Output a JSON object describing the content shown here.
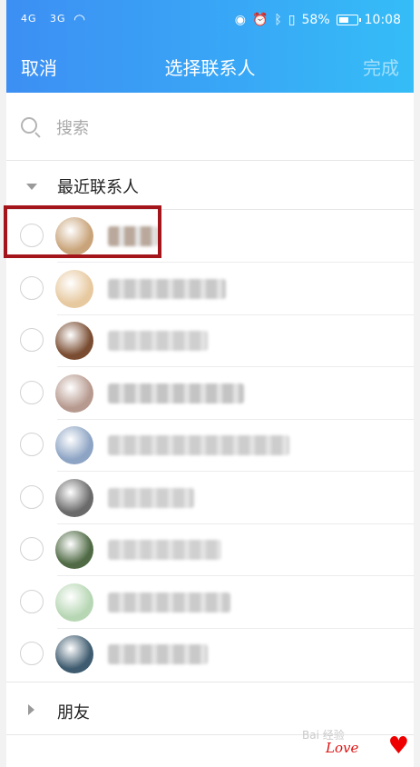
{
  "status_bar": {
    "signal1": "4G",
    "signal2": "3G",
    "battery": "58%",
    "time": "10:08"
  },
  "header": {
    "cancel": "取消",
    "title": "选择联系人",
    "done": "完成"
  },
  "search": {
    "placeholder": "搜索"
  },
  "recent_group": {
    "label": "最近联系人",
    "contacts": [
      {
        "name": "",
        "avatar": "#c9a47a"
      },
      {
        "name": "",
        "avatar": "#e7c9a0"
      },
      {
        "name": "",
        "avatar": "#7a4d32"
      },
      {
        "name": "",
        "avatar": "#b79a8f"
      },
      {
        "name": "",
        "avatar": "#8da4c4"
      },
      {
        "name": "",
        "avatar": "#6a6a6a"
      },
      {
        "name": "",
        "avatar": "#4f6a44"
      },
      {
        "name": "",
        "avatar": "#b7d7b4"
      },
      {
        "name": "",
        "avatar": "#3e5b6f"
      }
    ]
  },
  "friends_group": {
    "label": "朋友"
  },
  "watermark": {
    "brand": "Bai 经验",
    "love": "Love"
  }
}
